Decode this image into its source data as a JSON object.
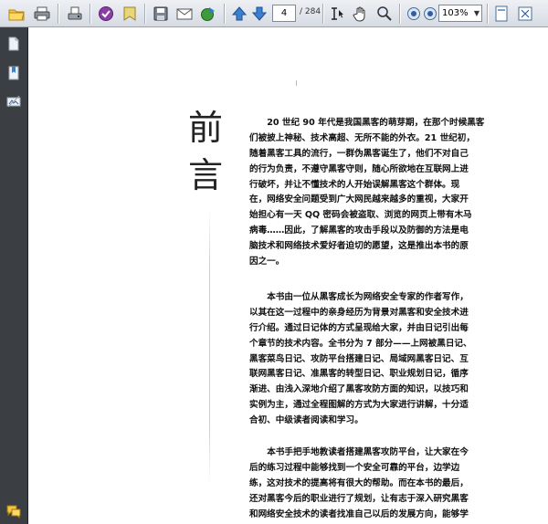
{
  "toolbar": {
    "current_page": "4",
    "total_pages": "/ 284",
    "zoom": "103%",
    "icons": [
      "open-folder-icon",
      "print-icon",
      "scan-icon",
      "purple-sign-icon",
      "ribbon-icon",
      "save-icon",
      "email-icon",
      "globe-icon",
      "arrow-up-icon",
      "arrow-down-icon",
      "select-text-icon",
      "hand-icon",
      "zoom-tool-icon",
      "zoom-out-icon",
      "zoom-in-icon",
      "single-page-icon",
      "fit-page-icon"
    ]
  },
  "nav": {
    "icons": [
      "pages-icon",
      "bookmarks-icon",
      "signatures-icon",
      "comments-icon"
    ]
  },
  "document": {
    "heading_char_1": "前",
    "heading_char_2": "言",
    "paragraphs": [
      [
        "20 世纪 90 年代是我国黑客的萌芽期，在那个时候黑客",
        "们被披上神秘、技术高超、无所不能的外衣。21 世纪初，",
        "随着黑客工具的流行，一群伪黑客诞生了，他们不对自己",
        "的行为负责，不遵守黑客守则，随心所欲地在互联网上进",
        "行破坏，并让不懂技术的人开始误解黑客这个群体。现",
        "在，网络安全问题受到广大网民越来越多的重视，大家开",
        "始担心有一天 QQ 密码会被盗取、浏览的网页上带有木马",
        "病毒……因此，了解黑客的攻击手段以及防御的方法是电",
        "脑技术和网络技术爱好者迫切的愿望，这是推出本书的原",
        "因之一。"
      ],
      [
        "本书由一位从黑客成长为网络安全专家的作者写作，",
        "以其在这一过程中的亲身经历为背景对黑客和安全技术进",
        "行介绍。通过日记体的方式呈现给大家，并由日记引出每",
        "个章节的技术内容。全书分为 7 部分——上网被黑日记、",
        "黑客菜鸟日记、攻防平台搭建日记、局域网黑客日记、互",
        "联网黑客日记、准黑客的转型日记、职业规划日记，循序",
        "渐进、由浅入深地介绍了黑客攻防方面的知识，以技巧和",
        "实例为主，通过全程图解的方式为大家进行讲解，十分适",
        "合初、中级读者阅读和学习。"
      ],
      [
        "本书手把手地教读者搭建黑客攻防平台，让大家在今",
        "后的练习过程中能够找到一个安全可靠的平台，边学边",
        "练，这对技术的提高将有很大的帮助。而在本书的最后，",
        "还对黑客今后的职业进行了规划，让有志于深入研究黑客",
        "和网络安全技术的读者找准自己以后的发展方向，能够学"
      ]
    ]
  }
}
